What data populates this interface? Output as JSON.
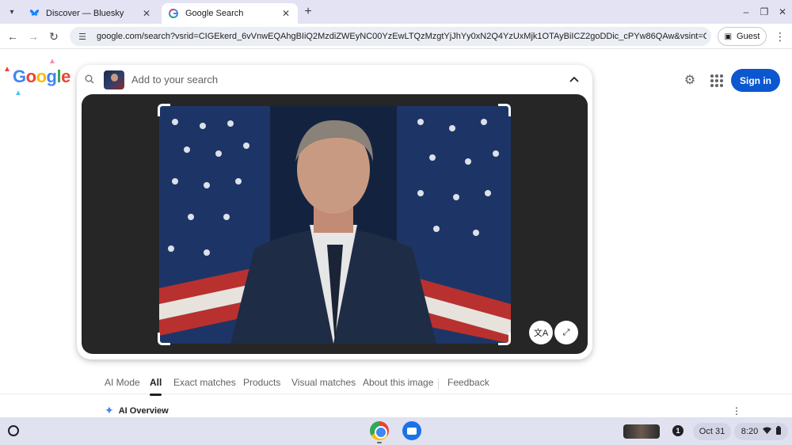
{
  "browser": {
    "tabs": [
      {
        "title": "Discover — Bluesky",
        "favicon": "butterfly-icon",
        "active": false
      },
      {
        "title": "Google Search",
        "favicon": "google-g-icon",
        "active": true
      }
    ],
    "url": "google.com/search?vsrid=CIGEkerd_6vVnwEQAhgBIiQ2MzdiZWEyNC00YzEwLTQzMzgtYjJhYy0xN2Q4YzUxMjk1OTAyBiICZ2goDDic_cPYw86QAw&vsint=CAIqDAoCCA...",
    "profile_label": "Guest"
  },
  "logo": {
    "letters": [
      "G",
      "o",
      "o",
      "g",
      "l",
      "e"
    ]
  },
  "search": {
    "placeholder": "Add to your search"
  },
  "header": {
    "signin_label": "Sign in"
  },
  "result_tabs": [
    {
      "label": "AI Mode",
      "active": false
    },
    {
      "label": "All",
      "active": true
    },
    {
      "label": "Exact matches",
      "active": false
    },
    {
      "label": "Products",
      "active": false
    },
    {
      "label": "Visual matches",
      "active": false
    },
    {
      "label": "About this image",
      "active": false
    },
    {
      "label": "Feedback",
      "active": false
    }
  ],
  "ai_overview": {
    "label": "AI Overview"
  },
  "shelf": {
    "notification_count": "1",
    "date": "Oct 31",
    "time": "8:20"
  },
  "colors": {
    "accent": "#0b57d0",
    "tabstrip": "#e3e3f4",
    "stage": "#262626"
  }
}
